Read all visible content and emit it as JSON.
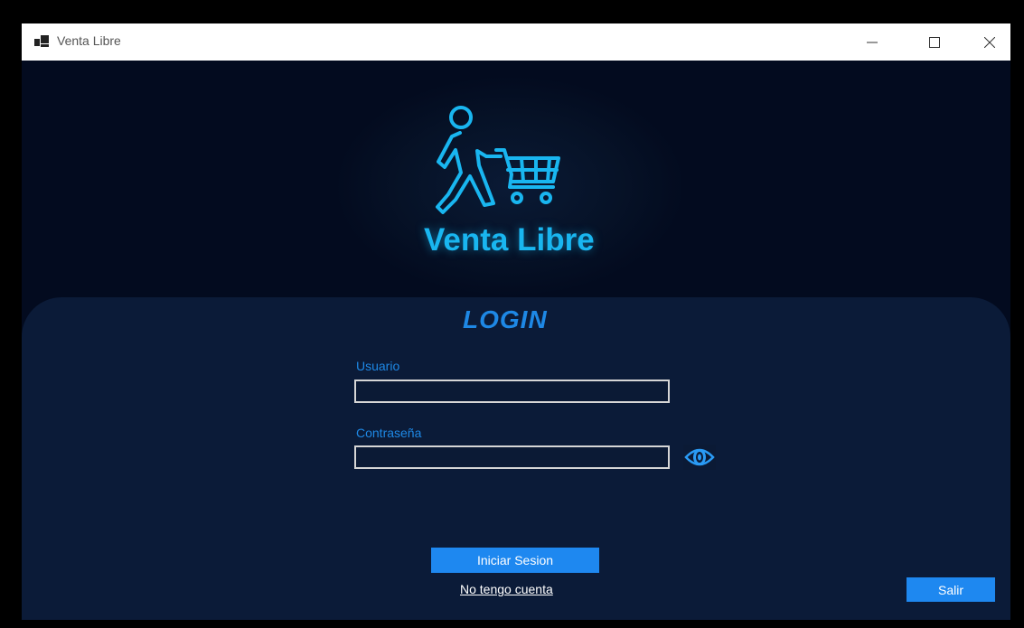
{
  "window": {
    "title": "Venta Libre",
    "icon": "app-window-icon",
    "controls": [
      "minimize-icon",
      "maximize-icon",
      "close-icon"
    ]
  },
  "logo": {
    "text": "Venta Libre",
    "icon": "shopping-cart-person-icon",
    "color": "#19b6f0"
  },
  "login": {
    "title": "LOGIN",
    "username_label": "Usuario",
    "username_value": "",
    "password_label": "Contraseña",
    "password_value": "",
    "show_password_icon": "eye-icon",
    "submit_label": "Iniciar Sesion",
    "register_link": "No tengo cuenta",
    "exit_label": "Salir"
  },
  "colors": {
    "background": "#030b1f",
    "panel": "#0b1b38",
    "accent": "#1e88e5",
    "button": "#1e88f0"
  }
}
